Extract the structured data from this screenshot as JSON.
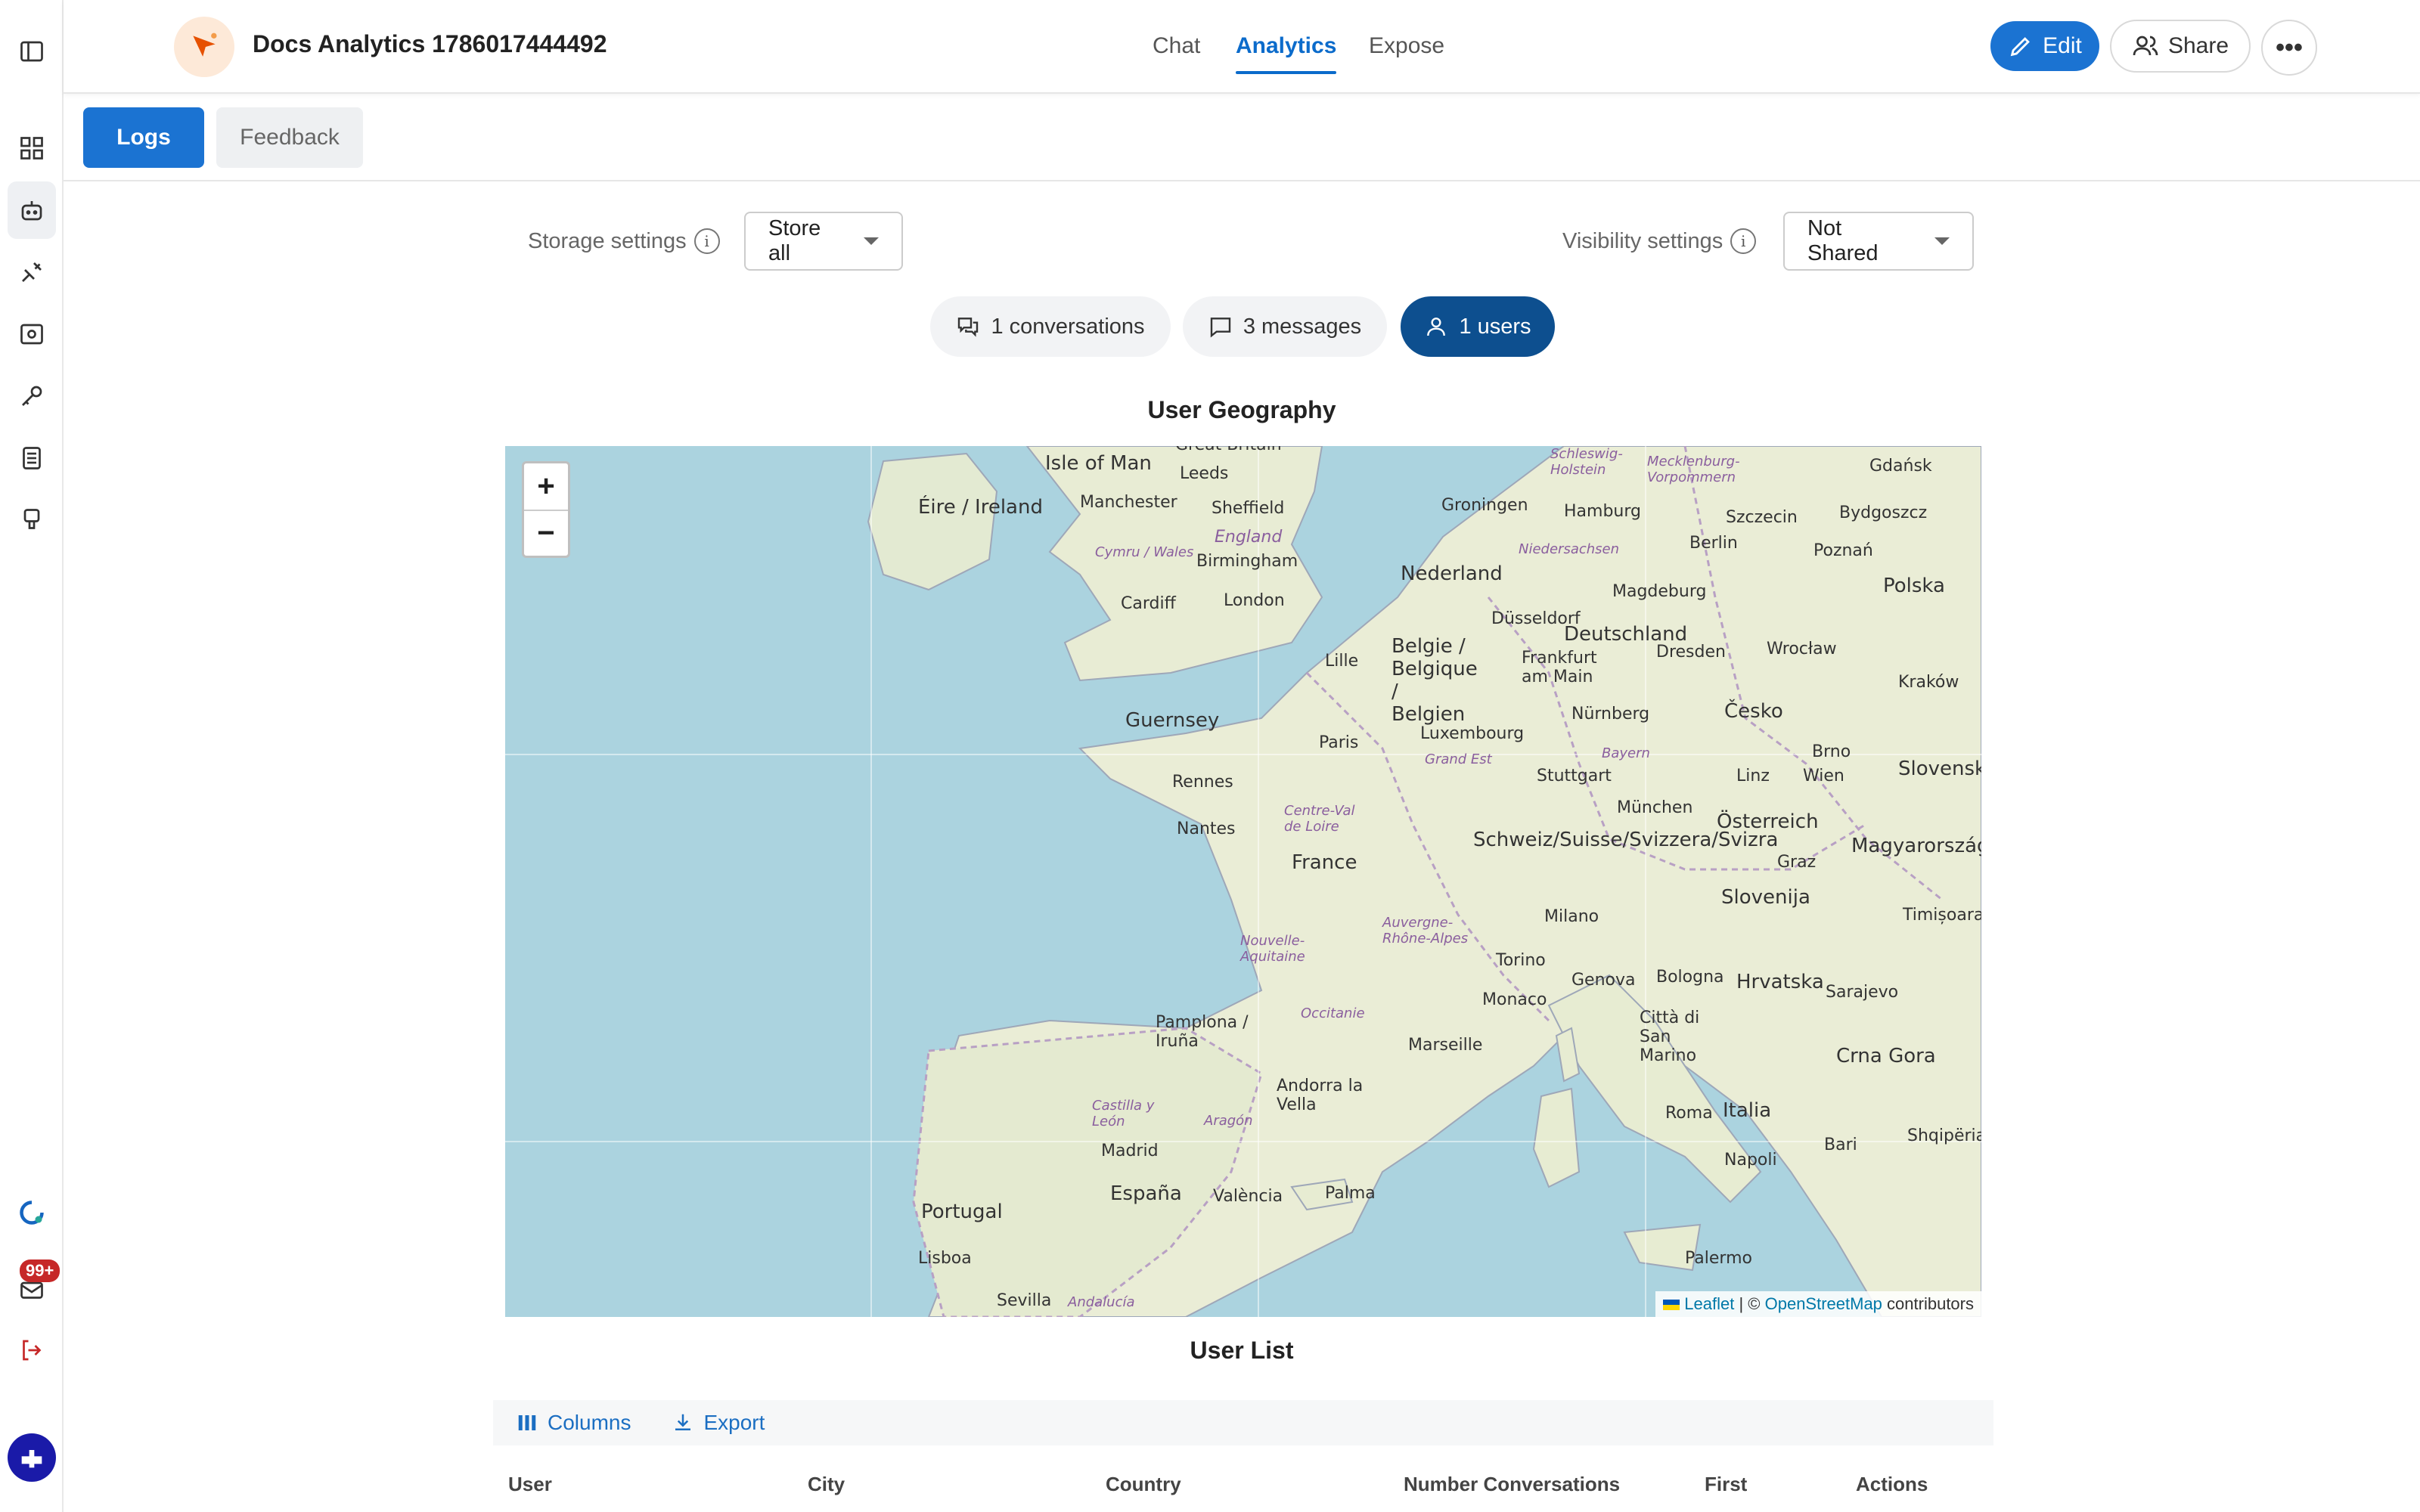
{
  "header": {
    "title": "Docs Analytics 1786017444492",
    "tabs": [
      "Chat",
      "Analytics",
      "Expose"
    ],
    "edit_label": "Edit",
    "share_label": "Share",
    "more_label": "•••"
  },
  "sidebar": {
    "badge": "99+",
    "items": [
      "panel-toggle-icon",
      "dashboard-icon",
      "bot-icon",
      "plug-icon",
      "scan-icon",
      "key-icon",
      "book-icon",
      "brush-icon",
      "help-icon",
      "mail-icon",
      "logout-icon",
      "avatar"
    ]
  },
  "subtabs": {
    "logs": "Logs",
    "feedback": "Feedback"
  },
  "settings": {
    "storage_label": "Storage settings",
    "storage_value": "Store all",
    "visibility_label": "Visibility settings",
    "visibility_value": "Not Shared"
  },
  "chips": {
    "conversations": "1 conversations",
    "messages": "3 messages",
    "users": "1 users"
  },
  "geography": {
    "title": "User Geography",
    "zoom_in": "+",
    "zoom_out": "−",
    "attribution_leaflet": "Leaflet",
    "attribution_sep": "| ©",
    "attribution_osm": "OpenStreetMap",
    "attribution_rest": "contributors",
    "labels": [
      "Isle of Man",
      "Éire / Ireland",
      "Manchester",
      "Leeds",
      "Sheffield",
      "England",
      "Birmingham",
      "Cymru / Wales",
      "Cardiff",
      "London",
      "Guernsey",
      "Lille",
      "Paris",
      "Rennes",
      "Nantes",
      "Centre-Val de Loire",
      "France",
      "Nouvelle-Aquitaine",
      "Occitanie",
      "Auvergne-Rhône-Alpes",
      "Marseille",
      "Pamplona / Iruña",
      "Andorra la Vella",
      "Aragón",
      "Castilla y León",
      "Madrid",
      "España",
      "València",
      "Palma",
      "Portugal",
      "Lisboa",
      "Sevilla",
      "Andalucía",
      "Groningen",
      "Hamburg",
      "Niedersachsen",
      "Nederland",
      "Magdeburg",
      "Berlin",
      "Szczecin",
      "Gdańsk",
      "Bydgoszcz",
      "Poznań",
      "Polska",
      "Düsseldorf",
      "Deutschland",
      "Belgie / Belgique / Belgien",
      "Frankfurt am Main",
      "Dresden",
      "Wrocław",
      "Kraków",
      "Luxembourg",
      "Nürnberg",
      "Česko",
      "Grand Est",
      "Bayern",
      "Stuttgart",
      "Linz",
      "Wien",
      "Brno",
      "Slovensko",
      "München",
      "Österreich",
      "Graz",
      "Magyarország",
      "Schweiz/Suisse/Svizzera/Svizra",
      "Milano",
      "Slovenija",
      "Timișoara",
      "Torino",
      "Genova",
      "Bologna",
      "Hrvatska",
      "Sarajevo",
      "Monaco",
      "Città di San Marino",
      "Crna Gora",
      "Roma",
      "Italia",
      "Bari",
      "Napoli",
      "Palermo",
      "Shqipëria",
      "Schleswig-Holstein",
      "Mecklenburg-Vorpommern",
      "Great Britain"
    ]
  },
  "user_list": {
    "title": "User List",
    "columns_label": "Columns",
    "export_label": "Export",
    "headers": [
      "User",
      "City",
      "Country",
      "Number Conversations",
      "First",
      "Actions"
    ]
  }
}
